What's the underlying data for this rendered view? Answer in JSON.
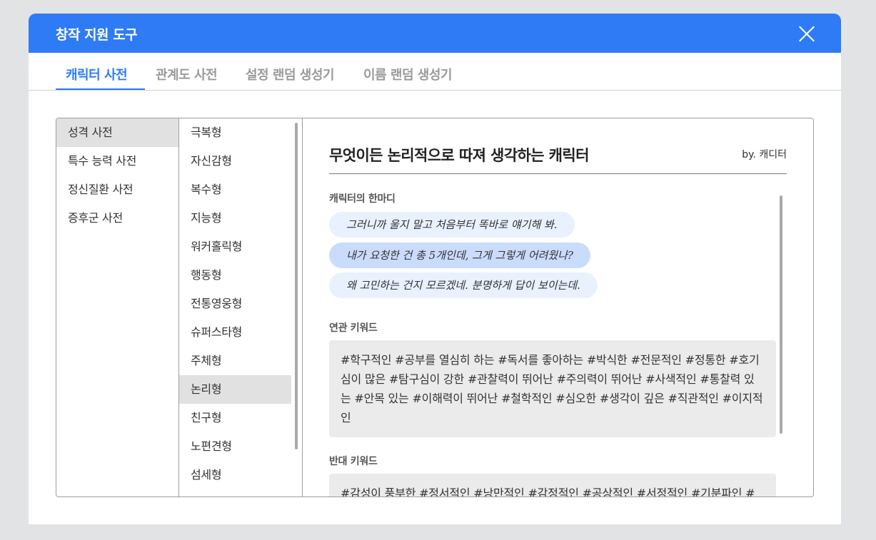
{
  "window": {
    "title": "창작 지원 도구"
  },
  "tabs": [
    {
      "label": "캐릭터 사전"
    },
    {
      "label": "관계도 사전"
    },
    {
      "label": "설정 랜덤 생성기"
    },
    {
      "label": "이름 랜덤 생성기"
    }
  ],
  "categories": [
    {
      "label": "성격 사전"
    },
    {
      "label": "특수 능력 사전"
    },
    {
      "label": "정신질환 사전"
    },
    {
      "label": "증후군 사전"
    }
  ],
  "types": [
    {
      "label": "극복형"
    },
    {
      "label": "자신감형"
    },
    {
      "label": "복수형"
    },
    {
      "label": "지능형"
    },
    {
      "label": "워커홀릭형"
    },
    {
      "label": "행동형"
    },
    {
      "label": "전통영웅형"
    },
    {
      "label": "슈퍼스타형"
    },
    {
      "label": "주체형"
    },
    {
      "label": "논리형"
    },
    {
      "label": "친구형"
    },
    {
      "label": "노편견형"
    },
    {
      "label": "섬세형"
    }
  ],
  "detail": {
    "title": "무엇이든 논리적으로 따져 생각하는 캐릭터",
    "author": "by. 캐디터",
    "quotes_label": "캐릭터의 한마디",
    "quotes": [
      "그러니까 울지 말고 처음부터 똑바로 얘기해 봐.",
      "내가 요청한 건 총 5개인데, 그게 그렇게 어려웠나?",
      "왜 고민하는 건지 모르겠네. 분명하게 답이 보이는데."
    ],
    "related_label": "연관 키워드",
    "related_keywords": "#학구적인 #공부를 열심히 하는 #독서를 좋아하는 #박식한 #전문적인 #정통한 #호기심이 많은 #탐구심이 강한 #관찰력이 뛰어난 #주의력이 뛰어난 #사색적인 #통찰력 있는 #안목 있는 #이해력이 뛰어난 #철학적인 #심오한 #생각이 깊은 #직관적인 #이지적인",
    "opposite_label": "반대 키워드",
    "opposite_keywords": "#감성이 풍부한 #정서적인 #낭만적인 #감정적인 #공상적인 #서정적인 #기분파인 #"
  },
  "colors": {
    "accent": "#2f7bf5",
    "quote_bg": "#e9f1fe",
    "quote_highlight": "#cadcfb",
    "selected_bg": "#e1e1e1"
  }
}
